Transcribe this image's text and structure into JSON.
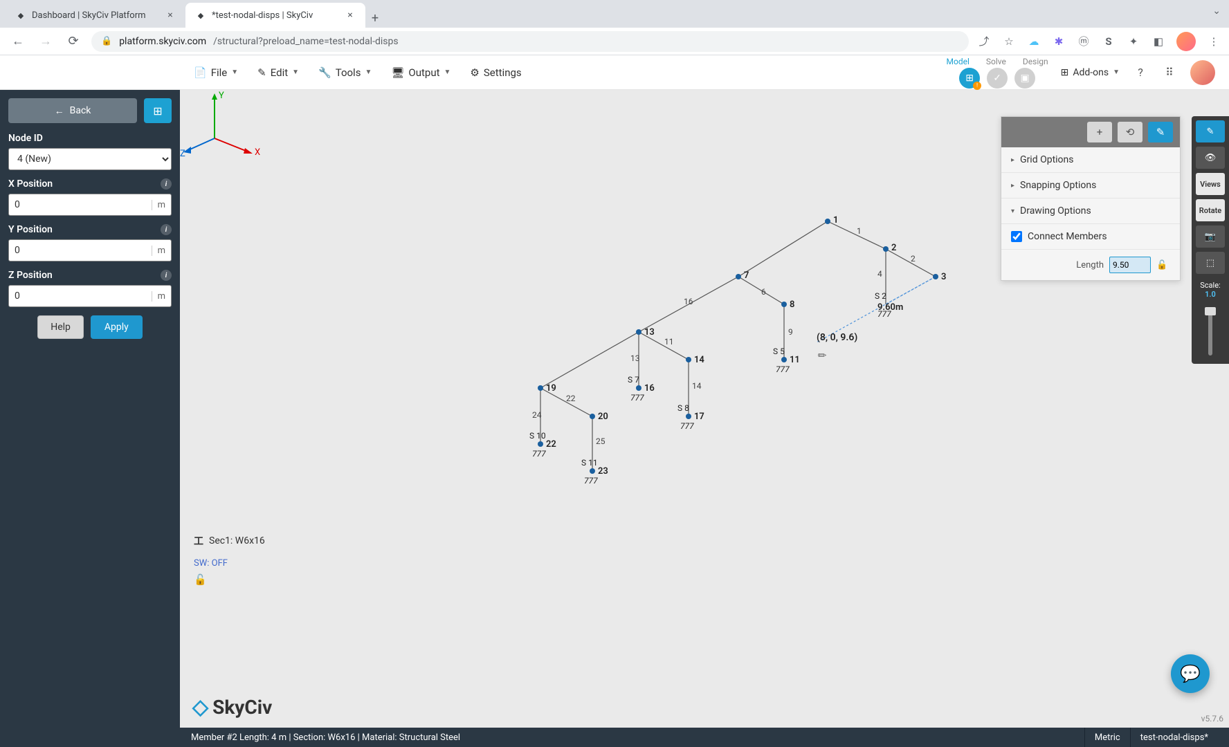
{
  "browser": {
    "tabs": [
      {
        "title": "Dashboard | SkyCiv Platform"
      },
      {
        "title": "*test-nodal-disps | SkyCiv"
      }
    ],
    "url_host": "platform.skyciv.com",
    "url_path": "/structural?preload_name=test-nodal-disps"
  },
  "menu": {
    "file": "File",
    "edit": "Edit",
    "tools": "Tools",
    "output": "Output",
    "settings": "Settings",
    "stages": {
      "model": "Model",
      "solve": "Solve",
      "design": "Design"
    },
    "addons": "Add-ons"
  },
  "sidebar": {
    "back": "Back",
    "node_id_label": "Node ID",
    "node_id_value": "4 (New)",
    "x_label": "X Position",
    "x_value": "0",
    "unit": "m",
    "y_label": "Y Position",
    "y_value": "0",
    "z_label": "Z Position",
    "z_value": "0",
    "help": "Help",
    "apply": "Apply"
  },
  "canvas": {
    "section": "Sec1: W6x16",
    "sw": "SW: OFF",
    "logo": "SkyCiv",
    "version": "v5.7.6",
    "coord_tip": "(8, 0, 9.6)",
    "draw_len": "9.60m",
    "axes": {
      "x": "X",
      "y": "Y",
      "z": "Z"
    },
    "labels": {
      "n1": "1",
      "n2": "2",
      "n3": "3",
      "n7": "7",
      "n8": "8",
      "n11": "11",
      "n13": "13",
      "n14": "14",
      "n16": "16",
      "n17": "17",
      "n19": "19",
      "n20": "20",
      "n22": "22",
      "n23": "23",
      "m1": "1",
      "m2": "2",
      "m4": "4",
      "m6": "6",
      "m9": "9",
      "m11": "11",
      "m13": "13",
      "m14": "14",
      "m16": "16",
      "m22": "22",
      "m24": "24",
      "m25": "25",
      "s2": "S 2",
      "s5": "S 5",
      "s7": "S 7",
      "s8": "S 8",
      "s10": "S 10",
      "s11": "S 11"
    }
  },
  "rpanel": {
    "grid": "Grid Options",
    "snap": "Snapping Options",
    "draw": "Drawing Options",
    "connect": "Connect Members",
    "length_label": "Length",
    "length_value": "9.50"
  },
  "rtoolbar": {
    "views": "Views",
    "rotate": "Rotate",
    "scale_label": "Scale:",
    "scale_value": "1.0"
  },
  "status": {
    "member_info": "Member #2 Length: 4 m | Section: W6x16 | Material: Structural Steel",
    "units": "Metric",
    "file": "test-nodal-disps*"
  }
}
